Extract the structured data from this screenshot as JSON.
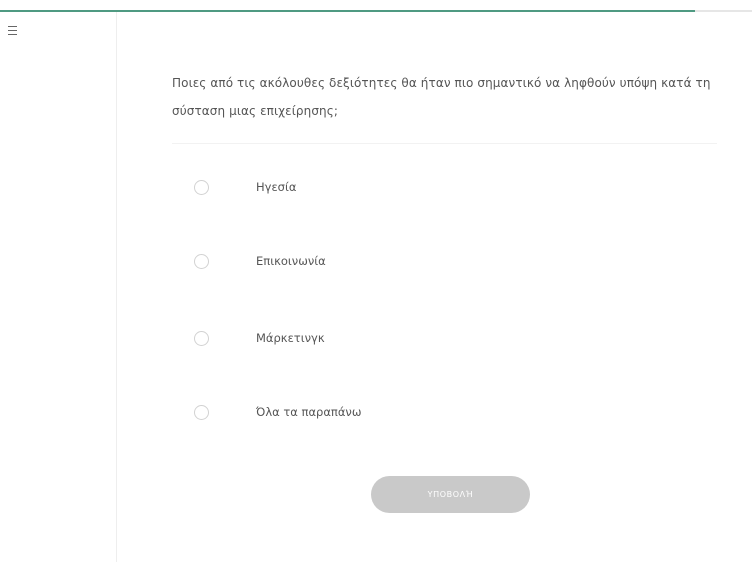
{
  "progress": {
    "fraction": 0.92,
    "accent_color": "#4f9a82"
  },
  "menu": {
    "icon": "hamburger-menu-icon"
  },
  "quiz": {
    "question": "Ποιες από τις ακόλουθες δεξιότητες θα ήταν πιο σημαντικό να ληφθούν υπόψη κατά τη σύσταση μιας επιχείρησης;",
    "options": [
      {
        "label": "Ηγεσία",
        "selected": false
      },
      {
        "label": "Επικοινωνία",
        "selected": false
      },
      {
        "label": "Μάρκετινγκ",
        "selected": false
      },
      {
        "label": "Όλα τα παραπάνω",
        "selected": false
      }
    ],
    "submit_label": "Υποβολή",
    "submit_disabled_color": "#c9c9c9"
  }
}
